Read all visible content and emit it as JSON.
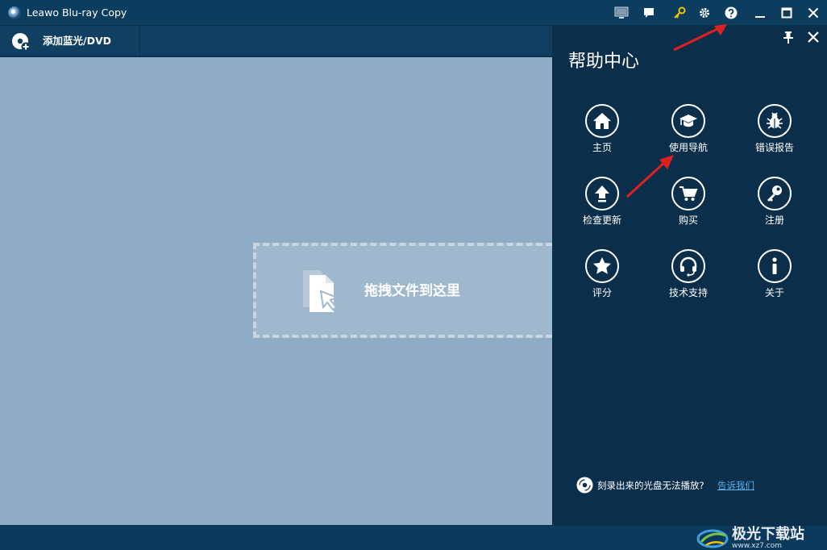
{
  "window": {
    "title": "Leawo Blu-ray Copy"
  },
  "toolbar": {
    "add_label": "添加蓝光/DVD"
  },
  "dropzone": {
    "label": "拖拽文件到这里"
  },
  "help_panel": {
    "title": "帮助中心",
    "items": [
      {
        "label": "主页",
        "icon": "home-icon"
      },
      {
        "label": "使用导航",
        "icon": "graduation-cap-icon"
      },
      {
        "label": "错误报告",
        "icon": "bug-icon"
      },
      {
        "label": "检查更新",
        "icon": "upload-arrow-icon"
      },
      {
        "label": "购买",
        "icon": "cart-icon"
      },
      {
        "label": "注册",
        "icon": "key-icon"
      },
      {
        "label": "评分",
        "icon": "star-icon"
      },
      {
        "label": "技术支持",
        "icon": "headset-icon"
      },
      {
        "label": "关于",
        "icon": "info-icon"
      }
    ],
    "footer_text": "刻录出来的光盘无法播放?",
    "footer_link": "告诉我们"
  },
  "watermark": {
    "text": "极光下载站",
    "sub": "www.xz7.com"
  },
  "colors": {
    "titlebar": "#0c3c5e",
    "main_bg": "#8facc4",
    "panel_bg": "#0b2f4a",
    "link": "#5db0ee",
    "annotation": "#e02020",
    "key_icon": "#f2c200"
  }
}
